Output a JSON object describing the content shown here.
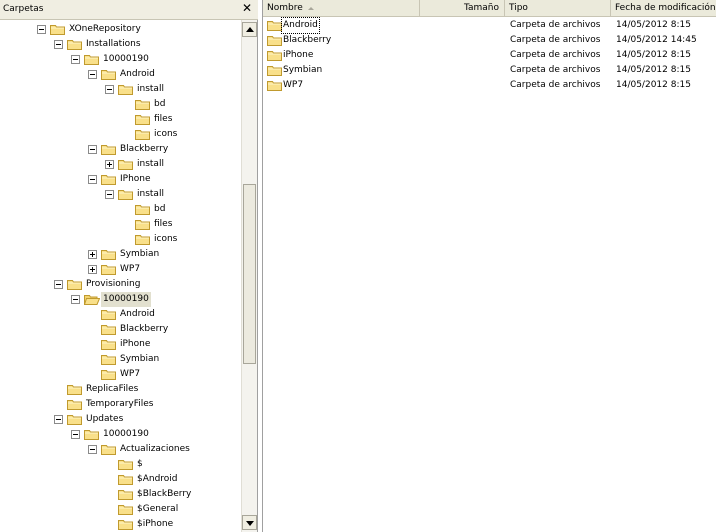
{
  "left_panel": {
    "title": "Carpetas",
    "close": "✕"
  },
  "tree": [
    {
      "label": "XOneRepository",
      "depth": 0,
      "exp": "minus"
    },
    {
      "label": "Installations",
      "depth": 1,
      "exp": "minus"
    },
    {
      "label": "10000190",
      "depth": 2,
      "exp": "minus"
    },
    {
      "label": "Android",
      "depth": 3,
      "exp": "minus"
    },
    {
      "label": "install",
      "depth": 4,
      "exp": "minus"
    },
    {
      "label": "bd",
      "depth": 5,
      "exp": "none"
    },
    {
      "label": "files",
      "depth": 5,
      "exp": "none"
    },
    {
      "label": "icons",
      "depth": 5,
      "exp": "none"
    },
    {
      "label": "Blackberry",
      "depth": 3,
      "exp": "minus"
    },
    {
      "label": "install",
      "depth": 4,
      "exp": "plus"
    },
    {
      "label": "IPhone",
      "depth": 3,
      "exp": "minus"
    },
    {
      "label": "install",
      "depth": 4,
      "exp": "minus"
    },
    {
      "label": "bd",
      "depth": 5,
      "exp": "none"
    },
    {
      "label": "files",
      "depth": 5,
      "exp": "none"
    },
    {
      "label": "icons",
      "depth": 5,
      "exp": "none"
    },
    {
      "label": "Symbian",
      "depth": 3,
      "exp": "plus"
    },
    {
      "label": "WP7",
      "depth": 3,
      "exp": "plus"
    },
    {
      "label": "Provisioning",
      "depth": 1,
      "exp": "minus"
    },
    {
      "label": "10000190",
      "depth": 2,
      "exp": "minus",
      "selected": true,
      "open": true
    },
    {
      "label": "Android",
      "depth": 3,
      "exp": "none"
    },
    {
      "label": "Blackberry",
      "depth": 3,
      "exp": "none"
    },
    {
      "label": "iPhone",
      "depth": 3,
      "exp": "none"
    },
    {
      "label": "Symbian",
      "depth": 3,
      "exp": "none"
    },
    {
      "label": "WP7",
      "depth": 3,
      "exp": "none"
    },
    {
      "label": "ReplicaFiles",
      "depth": 1,
      "exp": "none"
    },
    {
      "label": "TemporaryFiles",
      "depth": 1,
      "exp": "none"
    },
    {
      "label": "Updates",
      "depth": 1,
      "exp": "minus"
    },
    {
      "label": "10000190",
      "depth": 2,
      "exp": "minus"
    },
    {
      "label": "Actualizaciones",
      "depth": 3,
      "exp": "minus"
    },
    {
      "label": "$",
      "depth": 4,
      "exp": "none"
    },
    {
      "label": "$Android",
      "depth": 4,
      "exp": "none"
    },
    {
      "label": "$BlackBerry",
      "depth": 4,
      "exp": "none"
    },
    {
      "label": "$General",
      "depth": 4,
      "exp": "none"
    },
    {
      "label": "$iPhone",
      "depth": 4,
      "exp": "none"
    }
  ],
  "columns": {
    "nombre": "Nombre",
    "tamano": "Tamaño",
    "tipo": "Tipo",
    "fecha": "Fecha de modificación"
  },
  "files": [
    {
      "name": "Android",
      "type": "Carpeta de archivos",
      "date": "14/05/2012 8:15",
      "focused": true
    },
    {
      "name": "Blackberry",
      "type": "Carpeta de archivos",
      "date": "14/05/2012 14:45"
    },
    {
      "name": "iPhone",
      "type": "Carpeta de archivos",
      "date": "14/05/2012 8:15"
    },
    {
      "name": "Symbian",
      "type": "Carpeta de archivos",
      "date": "14/05/2012 8:15"
    },
    {
      "name": "WP7",
      "type": "Carpeta de archivos",
      "date": "14/05/2012 8:15"
    }
  ],
  "colors": {
    "folder_fill": "#f9e08a",
    "folder_stroke": "#c09a2e",
    "selection": "#e2e0cf",
    "header_bg": "#ebeadb"
  }
}
